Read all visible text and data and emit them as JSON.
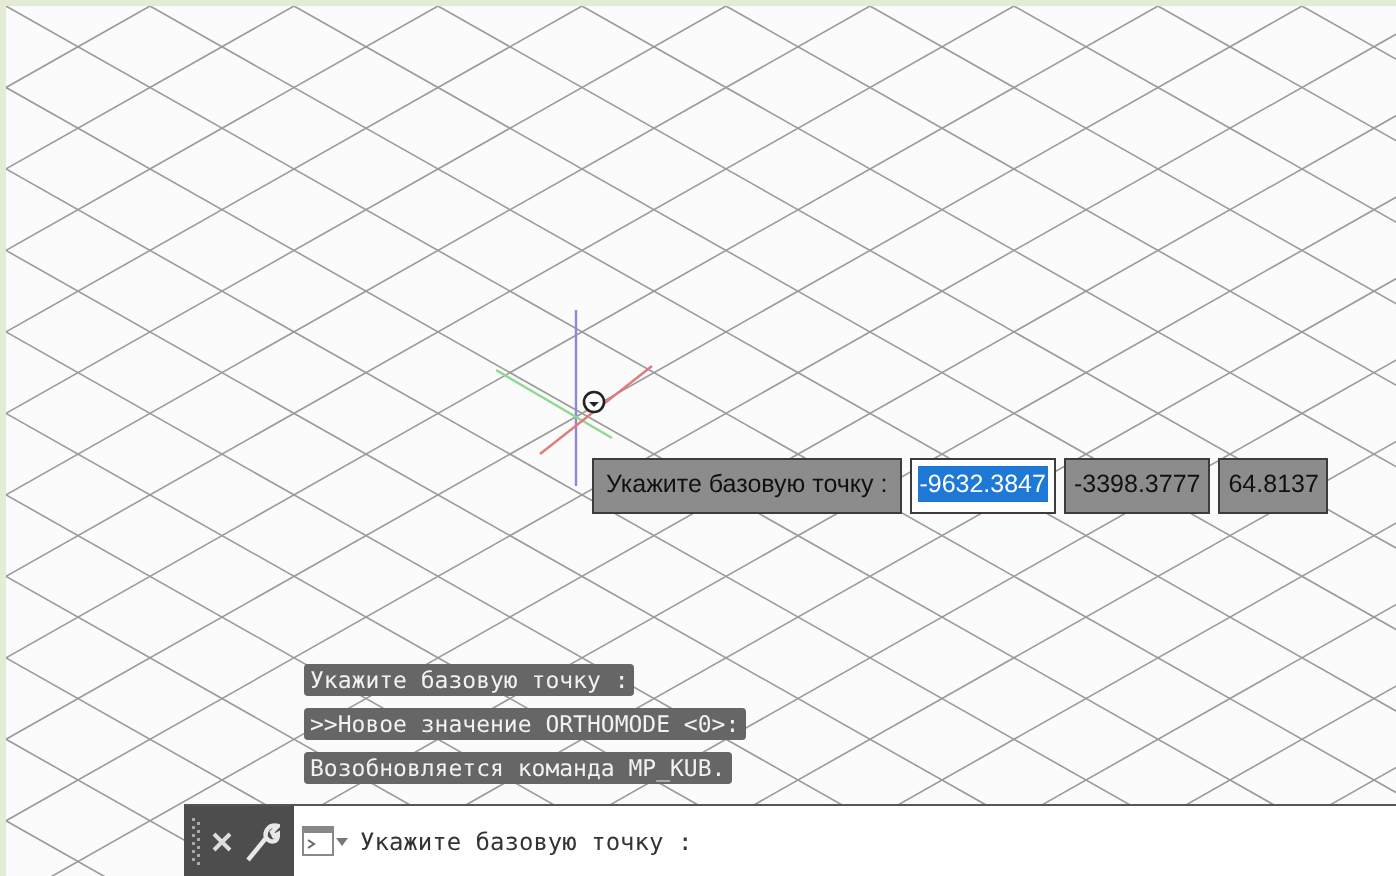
{
  "dynamic_input": {
    "prompt": "Укажите базовую точку :",
    "fields": [
      {
        "value": "-9632.3847",
        "selected": true
      },
      {
        "value": "-3398.3777",
        "selected": false
      },
      {
        "value": "64.8137",
        "selected": false
      }
    ]
  },
  "command_history": [
    "Укажите базовую точку :",
    ">>Новое значение ORTHOMODE <0>:",
    "Возобновляется команда MP_KUB."
  ],
  "command_line": {
    "prompt": "Укажите базовую точку :"
  }
}
